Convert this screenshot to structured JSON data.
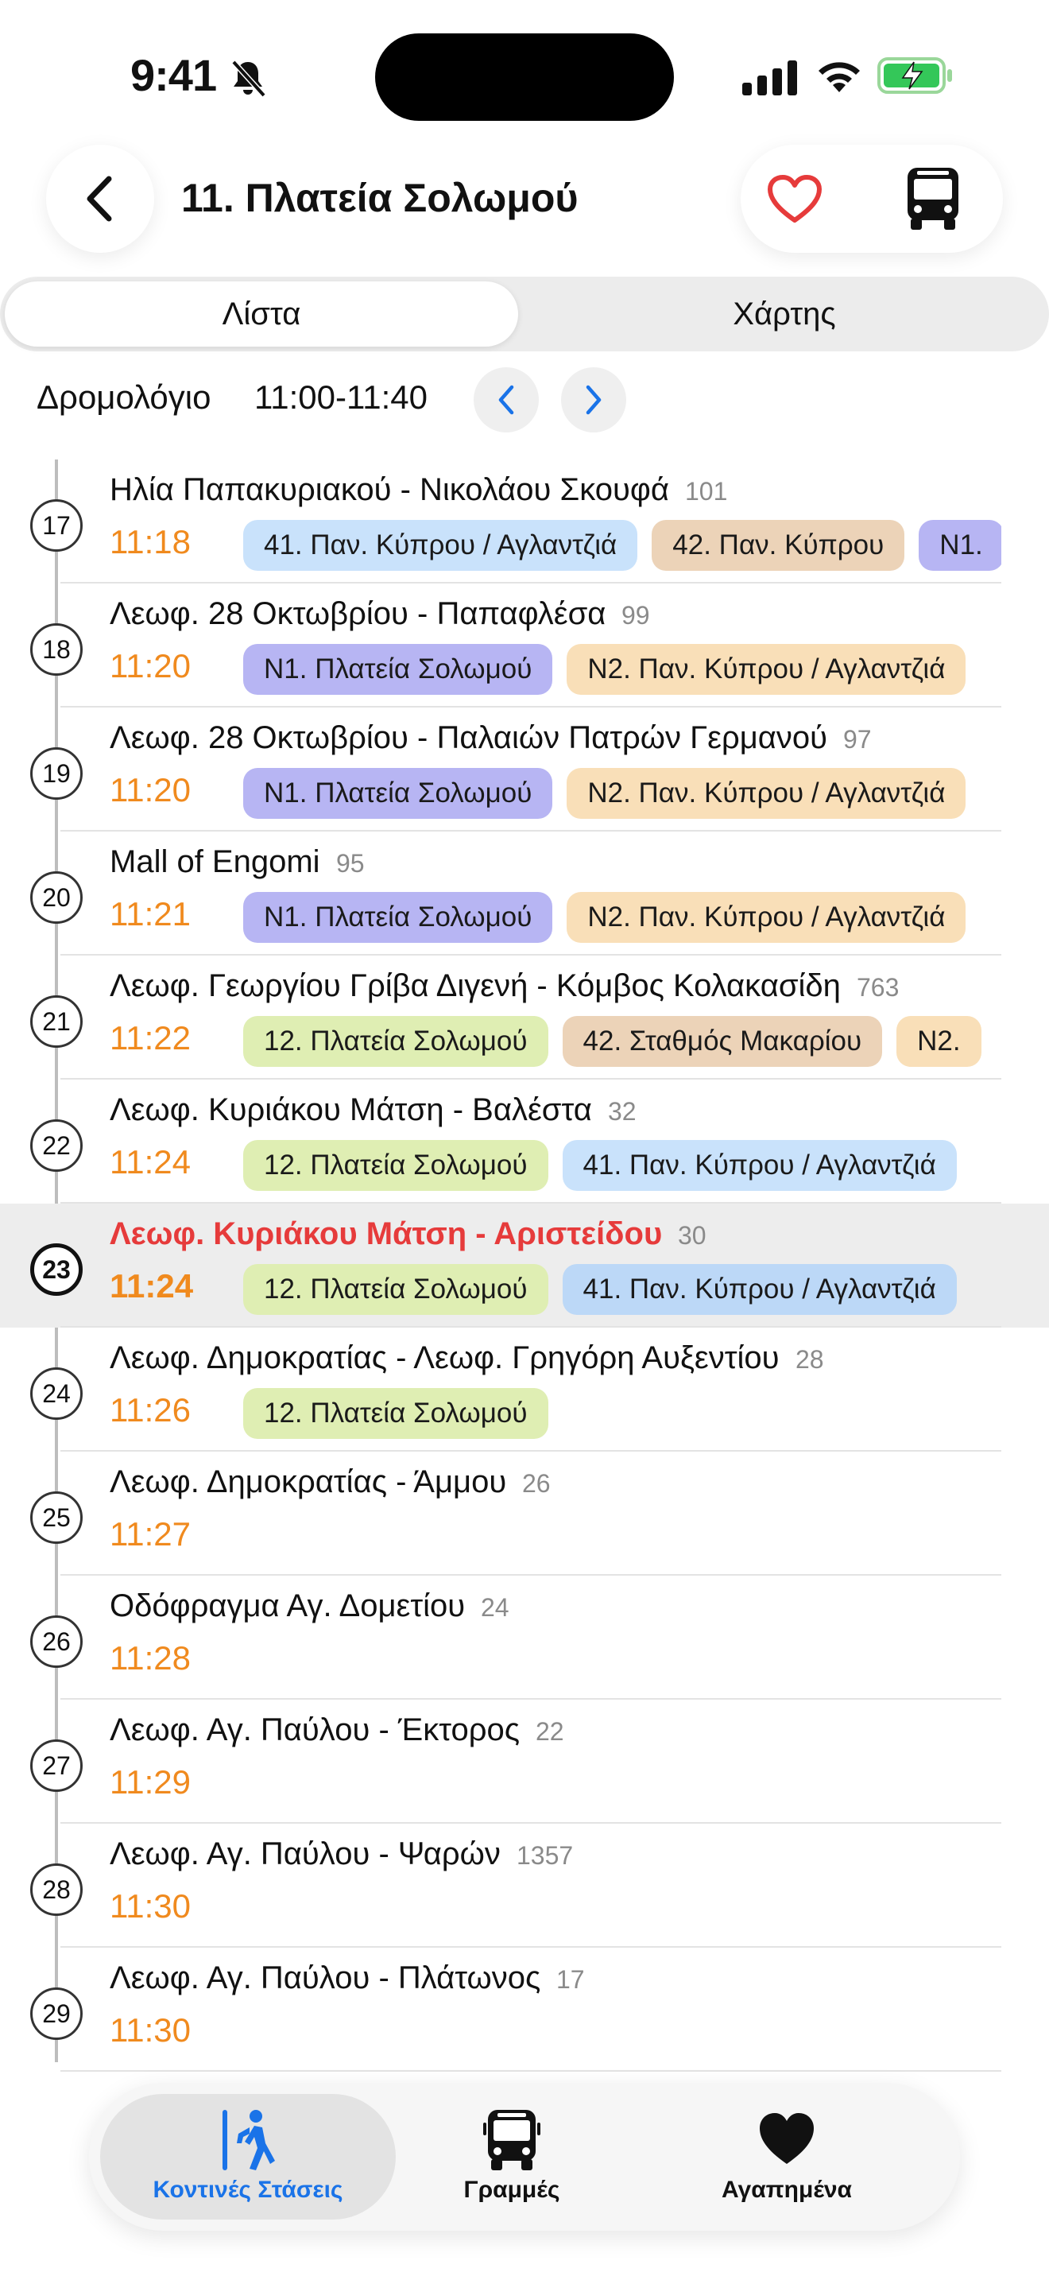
{
  "status_bar": {
    "time": "9:41",
    "icons": [
      "bell-slash-icon",
      "signal-icon",
      "wifi-icon",
      "battery-charging-icon"
    ]
  },
  "header": {
    "title": "11. Πλατεία Σολωμού",
    "back_icon": "chevron-left-icon",
    "favorite_icon": "heart-outline-icon",
    "bus_icon": "bus-icon"
  },
  "segments": {
    "list": "Λίστα",
    "map": "Χάρτης"
  },
  "schedule": {
    "label": "Δρομολόγιο",
    "range": "11:00-11:40"
  },
  "colors": {
    "accent": "#1a73e8",
    "time": "#f08a1e",
    "current_stop": "#e63b3b",
    "chip_blue": "#c9e2fb",
    "chip_orange_light": "#f9dfb8",
    "chip_tan": "#ecd3b8",
    "chip_purple": "#b7b5f3",
    "chip_green": "#dfeeb3",
    "chip_blue2": "#bcd8f7"
  },
  "stops": [
    {
      "num": "17",
      "name": "Ηλία Παπακυριακού - Νικολάου Σκουφά",
      "code": "101",
      "time": "11:18",
      "current": false,
      "routes": [
        {
          "label": "41. Παν. Κύπρου / Αγλαντζιά",
          "color": "#c9e2fb"
        },
        {
          "label": "42. Παν. Κύπρου",
          "color": "#ecd3b8"
        },
        {
          "label": "N1.",
          "color": "#b7b5f3"
        }
      ]
    },
    {
      "num": "18",
      "name": "Λεωφ. 28 Οκτωβρίου - Παπαφλέσα",
      "code": "99",
      "time": "11:20",
      "current": false,
      "routes": [
        {
          "label": "N1. Πλατεία Σολωμού",
          "color": "#b7b5f3"
        },
        {
          "label": "N2. Παν. Κύπρου / Αγλαντζιά",
          "color": "#f9dfb8"
        }
      ]
    },
    {
      "num": "19",
      "name": "Λεωφ. 28 Οκτωβρίου - Παλαιών Πατρών Γερμανού",
      "code": "97",
      "time": "11:20",
      "current": false,
      "routes": [
        {
          "label": "N1. Πλατεία Σολωμού",
          "color": "#b7b5f3"
        },
        {
          "label": "N2. Παν. Κύπρου / Αγλαντζιά",
          "color": "#f9dfb8"
        }
      ]
    },
    {
      "num": "20",
      "name": "Mall of Engomi",
      "code": "95",
      "time": "11:21",
      "current": false,
      "routes": [
        {
          "label": "N1. Πλατεία Σολωμού",
          "color": "#b7b5f3"
        },
        {
          "label": "N2. Παν. Κύπρου / Αγλαντζιά",
          "color": "#f9dfb8"
        }
      ]
    },
    {
      "num": "21",
      "name": "Λεωφ. Γεωργίου Γρίβα Διγενή - Κόμβος Κολακασίδη",
      "code": "763",
      "time": "11:22",
      "current": false,
      "routes": [
        {
          "label": "12. Πλατεία Σολωμού",
          "color": "#dfeeb3"
        },
        {
          "label": "42. Σταθμός Μακαρίου",
          "color": "#ecd3b8"
        },
        {
          "label": "N2.",
          "color": "#f9dfb8"
        }
      ]
    },
    {
      "num": "22",
      "name": "Λεωφ. Κυριάκου Μάτση - Βαλέστα",
      "code": "32",
      "time": "11:24",
      "current": false,
      "routes": [
        {
          "label": "12. Πλατεία Σολωμού",
          "color": "#dfeeb3"
        },
        {
          "label": "41. Παν. Κύπρου / Αγλαντζιά",
          "color": "#c9e2fb"
        }
      ]
    },
    {
      "num": "23",
      "name": "Λεωφ. Κυριάκου Μάτση - Αριστείδου",
      "code": "30",
      "time": "11:24",
      "current": true,
      "routes": [
        {
          "label": "12. Πλατεία Σολωμού",
          "color": "#dfeeb3"
        },
        {
          "label": "41. Παν. Κύπρου / Αγλαντζιά",
          "color": "#bcd8f7"
        }
      ]
    },
    {
      "num": "24",
      "name": "Λεωφ. Δημοκρατίας - Λεωφ. Γρηγόρη Αυξεντίου",
      "code": "28",
      "time": "11:26",
      "current": false,
      "routes": [
        {
          "label": "12. Πλατεία Σολωμού",
          "color": "#dfeeb3"
        }
      ]
    },
    {
      "num": "25",
      "name": "Λεωφ. Δημοκρατίας - Άμμου",
      "code": "26",
      "time": "11:27",
      "current": false,
      "routes": []
    },
    {
      "num": "26",
      "name": "Οδόφραγμα Αγ. Δομετίου",
      "code": "24",
      "time": "11:28",
      "current": false,
      "routes": []
    },
    {
      "num": "27",
      "name": "Λεωφ. Αγ. Παύλου - Έκτορος",
      "code": "22",
      "time": "11:29",
      "current": false,
      "routes": []
    },
    {
      "num": "28",
      "name": "Λεωφ. Αγ. Παύλου - Ψαρών",
      "code": "1357",
      "time": "11:30",
      "current": false,
      "routes": []
    },
    {
      "num": "29",
      "name": "Λεωφ. Αγ. Παύλου - Πλάτωνος",
      "code": "17",
      "time": "11:30",
      "current": false,
      "routes": []
    }
  ],
  "tabbar": {
    "nearby": {
      "label": "Κοντινές Στάσεις",
      "icon": "walking-person-icon"
    },
    "lines": {
      "label": "Γραμμές",
      "icon": "bus-icon"
    },
    "favorites": {
      "label": "Αγαπημένα",
      "icon": "heart-filled-icon"
    }
  }
}
